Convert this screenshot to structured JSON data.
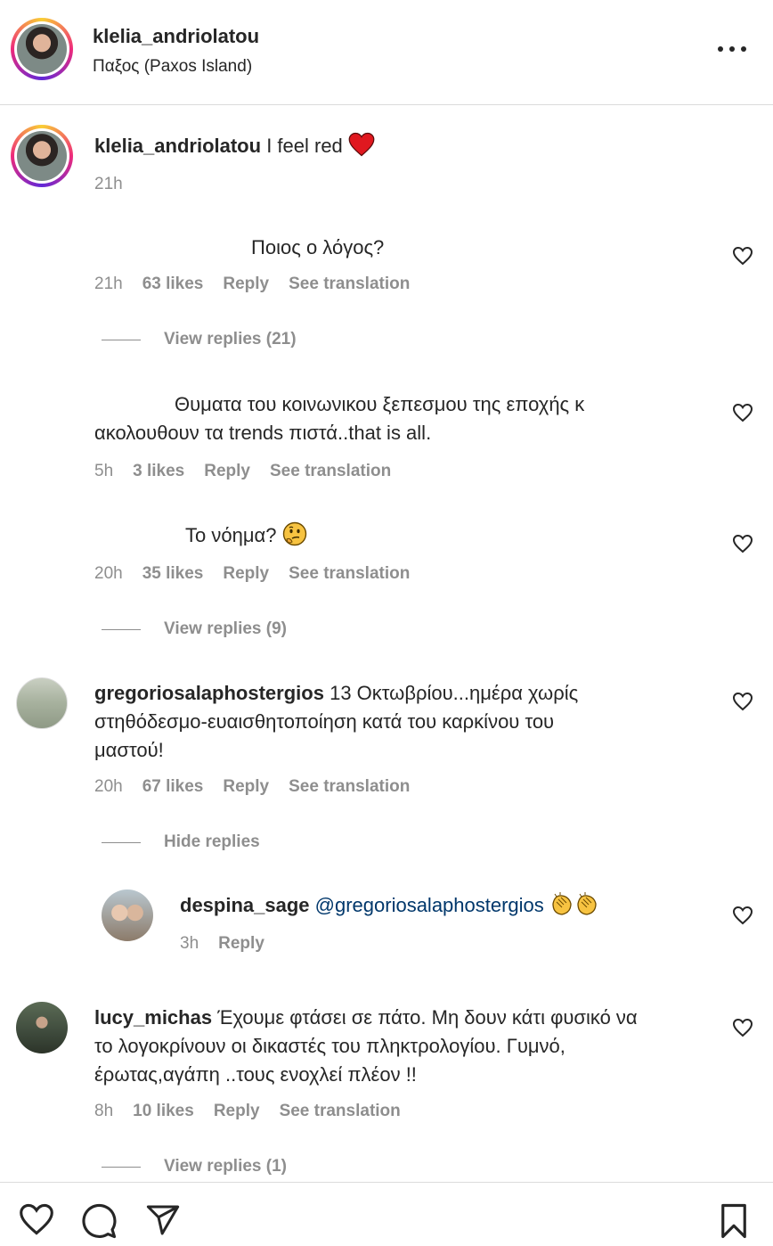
{
  "header": {
    "username": "klelia_andriolatou",
    "location": "Παξος (Paxos Island)",
    "more_icon": "more-horizontal-icon"
  },
  "caption": {
    "username": "klelia_andriolatou",
    "text": "I feel red",
    "emoji": "heart-emoji",
    "time": "21h"
  },
  "comments": [
    {
      "text": "Ποιος ο λόγος?",
      "time": "21h",
      "likes": "63 likes",
      "reply": "Reply",
      "translate": "See translation",
      "replies_label": "View replies (21)"
    },
    {
      "text_line1": "Θυματα του κοινωνικου ξεπεσμου της εποχής κ",
      "text_line2": "ακολουθουν τα trends πιστά..that is all.",
      "time": "5h",
      "likes": "3 likes",
      "reply": "Reply",
      "translate": "See translation"
    },
    {
      "text": "Το νόημα?",
      "emoji": "thinking-face-emoji",
      "time": "20h",
      "likes": "35 likes",
      "reply": "Reply",
      "translate": "See translation",
      "replies_label": "View replies (9)"
    },
    {
      "username": "gregoriosalaphostergios",
      "text_line1": "13 Οκτωβρίου...ημέρα χωρίς",
      "text_line2": "στηθόδεσμο-ευαισθητοποίηση κατά του καρκίνου του",
      "text_line3": "μαστού!",
      "time": "20h",
      "likes": "67 likes",
      "reply": "Reply",
      "translate": "See translation",
      "replies_label": "Hide replies"
    },
    {
      "username": "despina_sage",
      "mention": "@gregoriosalaphostergios",
      "emoji": "clapping-hands-emoji",
      "time": "3h",
      "reply": "Reply"
    },
    {
      "username": "lucy_michas",
      "text_line1": "Έχουμε φτάσει σε πάτο. Μη δουν κάτι φυσικό να",
      "text_line2": "το λογοκρίνουν οι δικαστές του πληκτρολογίου. Γυμνό,",
      "text_line3": "έρωτας,αγάπη ..τους ενοχλεί πλέον !!",
      "time": "8h",
      "likes": "10 likes",
      "reply": "Reply",
      "translate": "See translation",
      "replies_label": "View replies (1)"
    }
  ],
  "action_bar": {
    "icons": [
      "heart-icon",
      "comment-icon",
      "share-icon",
      "bookmark-icon"
    ]
  },
  "colors": {
    "text": "#262626",
    "secondary": "#8e8e8e",
    "mention": "#00376b",
    "heart_red": "#ed4956",
    "divider": "#dbdbdb"
  }
}
